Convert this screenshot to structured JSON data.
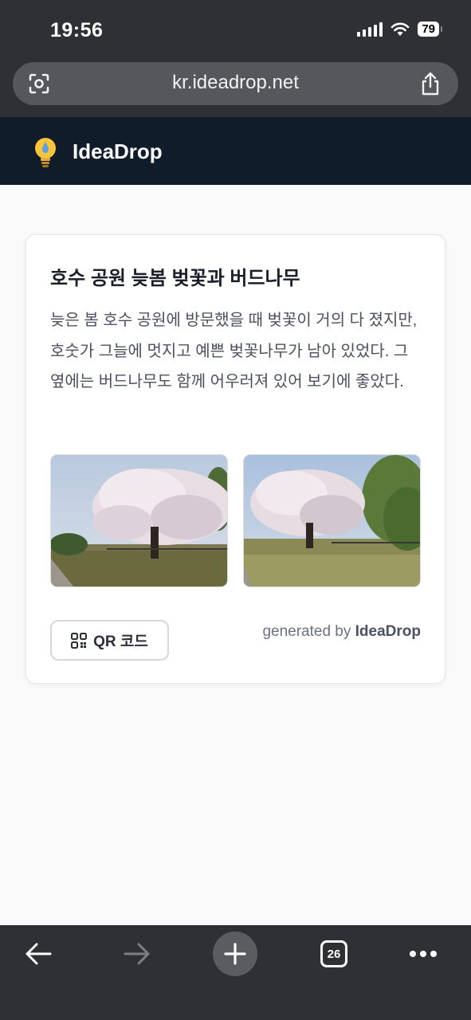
{
  "status_bar": {
    "time": "19:56",
    "battery": "79"
  },
  "browser": {
    "url": "kr.ideadrop.net",
    "tab_count": "26"
  },
  "site": {
    "name": "IdeaDrop"
  },
  "card": {
    "title": "호수 공원 늦봄 벚꽃과 버드나무",
    "description": "늦은 봄 호수 공원에 방문했을 때 벚꽃이 거의 다 졌지만, 호숫가 그늘에 멋지고 예쁜 벚꽃나무가 남아 있었다. 그 옆에는 버드나무도 함께 어우러져 있어 보기에 좋았다.",
    "qr_button": "QR 코드",
    "generated_prefix": "generated by",
    "generated_brand": "IdeaDrop"
  },
  "icons": {
    "camera-search": "camera-search-icon",
    "share": "share-icon",
    "lightbulb": "lightbulb-icon",
    "qr": "qr-icon",
    "back": "back-arrow-icon",
    "forward": "forward-arrow-icon",
    "new-tab": "plus-icon",
    "menu": "more-icon"
  },
  "colors": {
    "header_bg": "#111c2b",
    "chrome_bg": "#2f3033",
    "accent_bulb": "#f7c43c"
  }
}
